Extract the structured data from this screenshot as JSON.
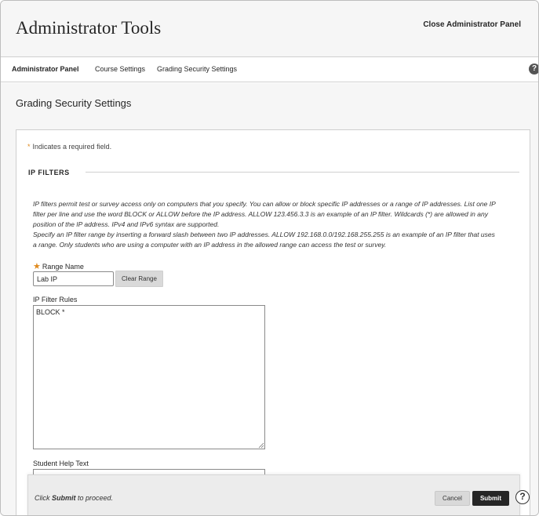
{
  "header": {
    "title": "Administrator Tools",
    "close_label": "Close Administrator Panel"
  },
  "nav": {
    "tabs": [
      {
        "label": "Administrator Panel",
        "active": true
      },
      {
        "label": "Course Settings",
        "active": false
      },
      {
        "label": "Grading Security Settings",
        "active": false
      }
    ],
    "help_glyph": "?"
  },
  "page": {
    "heading": "Grading Security Settings",
    "required_note_star": "*",
    "required_note": "Indicates a required field.",
    "section_title": "IP FILTERS",
    "instructions": [
      "IP filters permit test or survey access only on computers that you specify. You can allow or block specific IP addresses or a range of IP addresses. List one IP filter per line and use the word BLOCK or ALLOW before the IP address. ALLOW 123.456.3.3 is an example of an IP filter. Wildcards (*) are allowed in any position of the IP address. IPv4 and IPv6 syntax are supported.",
      "Specify an IP filter range by inserting a forward slash between two IP addresses. ALLOW 192.168.0.0/192.168.255.255 is an example of an IP filter that uses a range. Only students who are using a computer with an IP address in the allowed range can access the test or survey."
    ],
    "range_name_label": "Range Name",
    "range_name_value": "Lab IP",
    "clear_range_label": "Clear Range",
    "rules_label": "IP Filter Rules",
    "rules_value": "BLOCK *",
    "help_text_label": "Student Help Text",
    "help_text_value": ""
  },
  "submit_bar": {
    "hint_prefix": "Click ",
    "hint_bold": "Submit",
    "hint_suffix": " to proceed.",
    "cancel_label": "Cancel",
    "submit_label": "Submit"
  },
  "help_icon_glyph": "?",
  "colors": {
    "accent_star": "#e08a1e",
    "primary_button": "#262626",
    "header_bg": "#f6f6f6"
  }
}
